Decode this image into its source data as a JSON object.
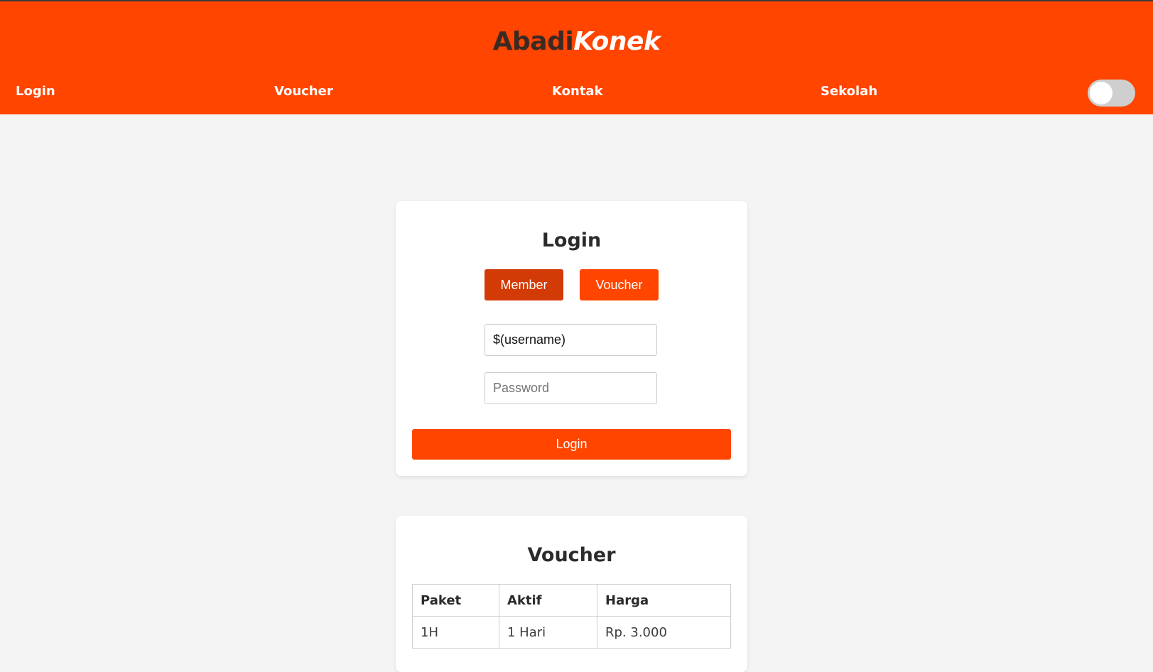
{
  "brand": {
    "part1": "Abadi",
    "part2": "Konek"
  },
  "nav": {
    "items": [
      "Login",
      "Voucher",
      "Kontak",
      "Sekolah"
    ]
  },
  "theme_toggle": {
    "state": "off"
  },
  "login_card": {
    "title": "Login",
    "tabs": {
      "member": "Member",
      "voucher": "Voucher"
    },
    "username_value": "$(username)",
    "password_placeholder": "Password",
    "submit_label": "Login"
  },
  "voucher_card": {
    "title": "Voucher",
    "columns": [
      "Paket",
      "Aktif",
      "Harga"
    ],
    "rows": [
      [
        "1H",
        "1 Hari",
        "Rp. 3.000"
      ]
    ]
  },
  "colors": {
    "accent": "#ff4500",
    "accent_dark": "#d23a06",
    "brand_dark": "#3b2a24",
    "background": "#f4f4f4"
  }
}
